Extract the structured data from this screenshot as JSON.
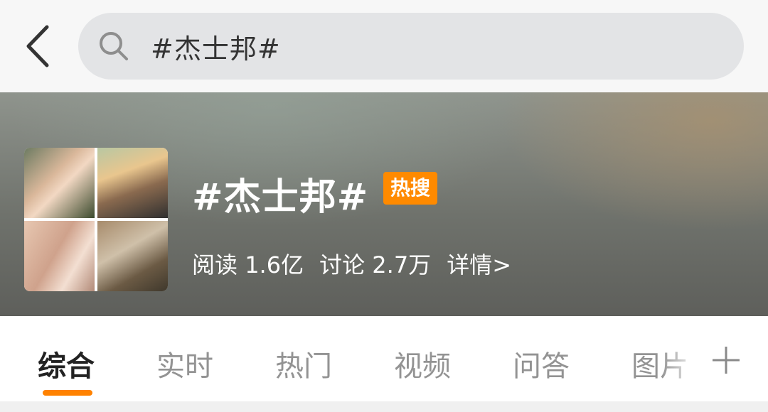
{
  "search": {
    "query": "#杰士邦#"
  },
  "topic": {
    "title": "#杰士邦#",
    "badge": "热搜",
    "reads_label": "阅读",
    "reads_value": "1.6亿",
    "discussions_label": "讨论",
    "discussions_value": "2.7万",
    "details_label": "详情>"
  },
  "tabs": [
    {
      "label": "综合",
      "active": true
    },
    {
      "label": "实时",
      "active": false
    },
    {
      "label": "热门",
      "active": false
    },
    {
      "label": "视频",
      "active": false
    },
    {
      "label": "问答",
      "active": false
    },
    {
      "label": "图片",
      "active": false
    }
  ],
  "icons": {
    "back": "chevron-left-icon",
    "search": "search-icon",
    "add": "plus-icon"
  },
  "colors": {
    "accent": "#ff8200",
    "badge": "#ff8a00"
  }
}
